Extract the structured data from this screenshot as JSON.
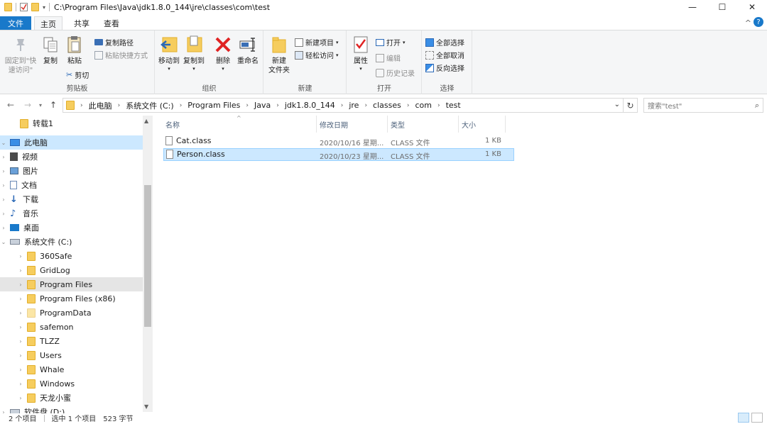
{
  "window": {
    "title": "C:\\Program Files\\Java\\jdk1.8.0_144\\jre\\classes\\com\\test",
    "minimize": "—",
    "maximize": "☐",
    "close": "✕"
  },
  "tabs": {
    "file": "文件",
    "home": "主页",
    "share": "共享",
    "view": "查看"
  },
  "ribbon": {
    "clipboard": {
      "label": "剪贴板",
      "pin": "固定到\"快\n速访问\"",
      "copy": "复制",
      "paste": "粘贴",
      "copy_path": "复制路径",
      "paste_shortcut": "粘贴快捷方式",
      "cut": "剪切"
    },
    "organize": {
      "label": "组织",
      "move_to": "移动到",
      "copy_to": "复制到",
      "delete": "删除",
      "rename": "重命名"
    },
    "new": {
      "label": "新建",
      "new_folder": "新建\n文件夹",
      "new_item": "新建项目",
      "easy_access": "轻松访问"
    },
    "open": {
      "label": "打开",
      "properties": "属性",
      "open": "打开",
      "edit": "编辑",
      "history": "历史记录"
    },
    "select": {
      "label": "选择",
      "select_all": "全部选择",
      "select_none": "全部取消",
      "invert": "反向选择"
    }
  },
  "address": {
    "crumbs": [
      "此电脑",
      "系统文件 (C:)",
      "Program Files",
      "Java",
      "jdk1.8.0_144",
      "jre",
      "classes",
      "com",
      "test"
    ],
    "search_placeholder": "搜索\"test\""
  },
  "nav": {
    "items": [
      {
        "label": "转载1",
        "icon": "folder-icon"
      },
      {
        "label": "此电脑",
        "icon": "computer-icon"
      },
      {
        "label": "视频",
        "icon": "video-icon"
      },
      {
        "label": "图片",
        "icon": "pictures-icon"
      },
      {
        "label": "文档",
        "icon": "documents-icon"
      },
      {
        "label": "下载",
        "icon": "download-icon"
      },
      {
        "label": "音乐",
        "icon": "music-icon"
      },
      {
        "label": "桌面",
        "icon": "desktop-icon"
      },
      {
        "label": "系统文件 (C:)",
        "icon": "drive-icon"
      },
      {
        "label": "360Safe",
        "icon": "folder-icon"
      },
      {
        "label": "GridLog",
        "icon": "folder-icon"
      },
      {
        "label": "Program Files",
        "icon": "folder-icon"
      },
      {
        "label": "Program Files (x86)",
        "icon": "folder-icon"
      },
      {
        "label": "ProgramData",
        "icon": "folder-icon"
      },
      {
        "label": "safemon",
        "icon": "folder-icon"
      },
      {
        "label": "TLZZ",
        "icon": "folder-icon"
      },
      {
        "label": "Users",
        "icon": "folder-icon"
      },
      {
        "label": "Whale",
        "icon": "folder-icon"
      },
      {
        "label": "Windows",
        "icon": "folder-icon"
      },
      {
        "label": "天龙小蜜",
        "icon": "folder-icon"
      },
      {
        "label": "软件盘 (D:)",
        "icon": "drive-icon"
      }
    ]
  },
  "list": {
    "columns": {
      "name": "名称",
      "date": "修改日期",
      "type": "类型",
      "size": "大小"
    },
    "files": [
      {
        "name": "Cat.class",
        "date": "2020/10/16 星期...",
        "type": "CLASS 文件",
        "size": "1 KB"
      },
      {
        "name": "Person.class",
        "date": "2020/10/23 星期...",
        "type": "CLASS 文件",
        "size": "1 KB"
      }
    ]
  },
  "status": {
    "count": "2 个项目",
    "selected": "选中 1 个项目",
    "size": "523 字节"
  },
  "colors": {
    "accent": "#1979ca",
    "selection": "#cce8ff",
    "folder": "#f6cd5e"
  }
}
